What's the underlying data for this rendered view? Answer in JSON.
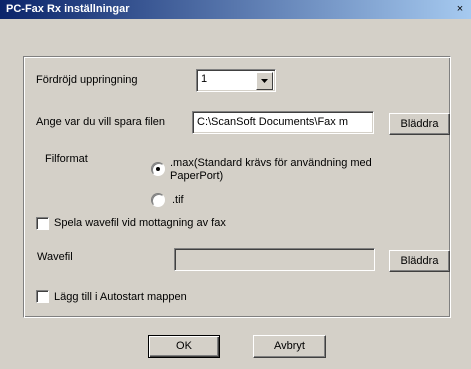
{
  "window": {
    "title": "PC-Fax Rx inställningar",
    "close_glyph": "×"
  },
  "delay": {
    "label": "Fördröjd uppringning",
    "value": "1"
  },
  "save_location": {
    "label": "Ange var du vill spara filen",
    "value": "C:\\ScanSoft Documents\\Fax m",
    "browse_label": "Bläddra"
  },
  "file_format": {
    "label": "Filformat",
    "options": [
      {
        "line1": ".max(Standard krävs för användning med",
        "line2": "PaperPort)",
        "selected": true
      },
      {
        "line1": ".tif",
        "selected": false
      }
    ]
  },
  "wave_on_receive": {
    "label": "Spela wavefil vid mottagning av fax",
    "checked": false
  },
  "wave_file": {
    "label": "Wavefil",
    "value": "",
    "browse_label": "Bläddra",
    "enabled": false
  },
  "autostart": {
    "label": "Lägg till i Autostart mappen",
    "checked": false
  },
  "buttons": {
    "ok": "OK",
    "cancel": "Avbryt"
  },
  "colors": {
    "titlebar_start": "#0a246a",
    "titlebar_end": "#a6caf0",
    "dialog_bg": "#d4d0c8"
  }
}
